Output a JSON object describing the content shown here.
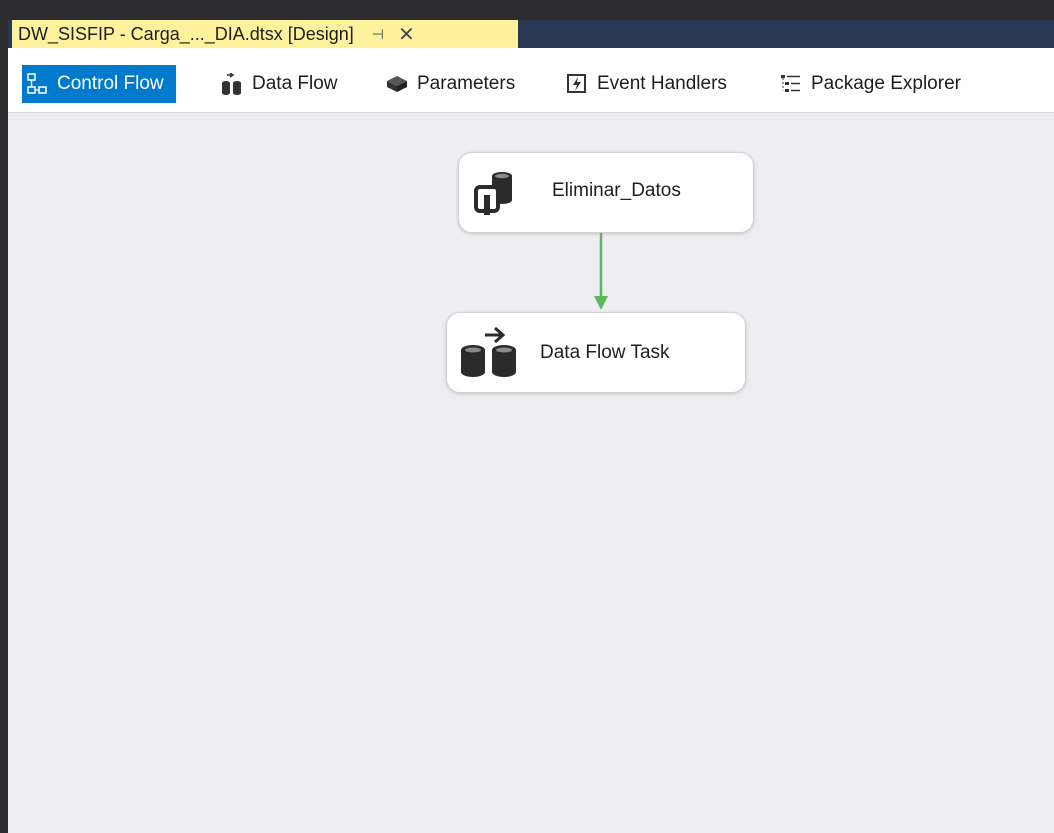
{
  "document_tab": {
    "title": "DW_SISFIP - Carga_..._DIA.dtsx [Design]",
    "pin_glyph": "⊣",
    "close_glyph": "✕"
  },
  "designer_tabs": [
    {
      "label": "Control Flow",
      "icon": "control-flow-icon",
      "active": true
    },
    {
      "label": "Data Flow",
      "icon": "data-flow-icon",
      "active": false
    },
    {
      "label": "Parameters",
      "icon": "parameters-icon",
      "active": false
    },
    {
      "label": "Event Handlers",
      "icon": "event-handlers-icon",
      "active": false
    },
    {
      "label": "Package Explorer",
      "icon": "package-explorer-icon",
      "active": false
    }
  ],
  "tasks": [
    {
      "label": "Eliminar_Datos",
      "icon": "execute-sql-task-icon"
    },
    {
      "label": "Data Flow Task",
      "icon": "data-flow-task-icon"
    }
  ],
  "colors": {
    "accent": "#007acc",
    "tab_highlight": "#fff29d",
    "tab_bar": "#293955",
    "connector_success": "#5cb85c",
    "canvas": "#eeeef2"
  }
}
